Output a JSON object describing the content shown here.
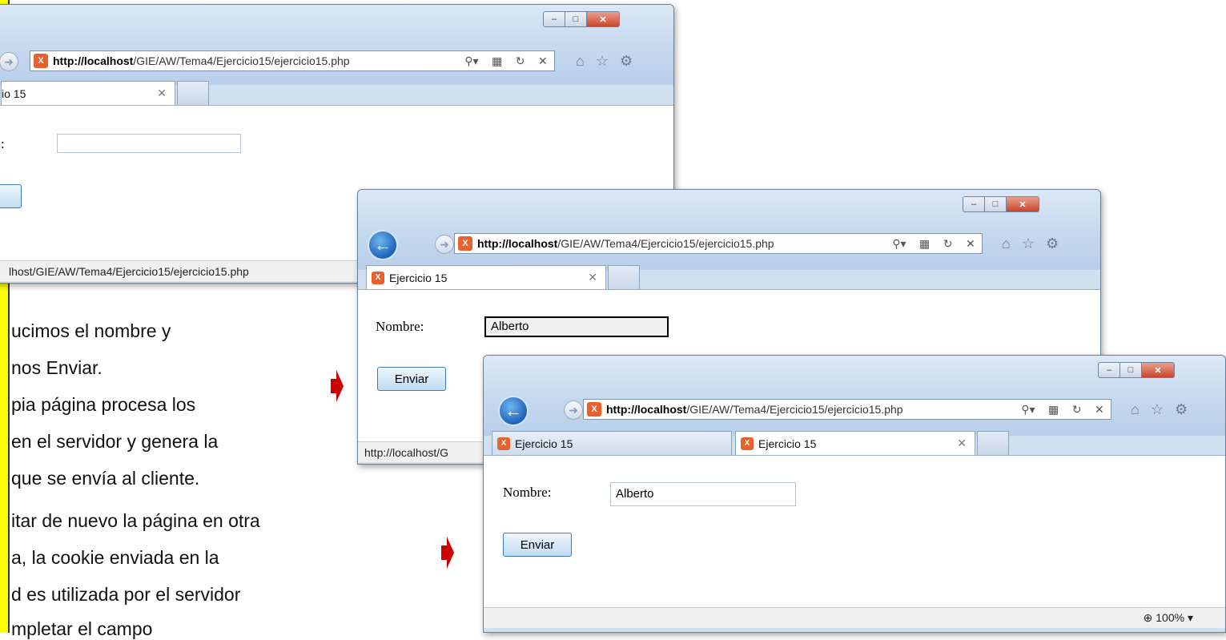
{
  "slide": {
    "lines_group1": [
      "ucimos el nombre y",
      "nos Enviar.",
      "pia página procesa los",
      "en el servidor y genera la",
      " que se envía al cliente."
    ],
    "lines_group2": [
      "itar de nuevo la página en otra",
      "a, la cookie enviada en la",
      "d es utilizada por el servidor",
      "mpletar el campo"
    ]
  },
  "window1": {
    "url_host": "http://localhost",
    "url_path": "/GIE/AW/Tema4/Ejercicio15/ejercicio15.php",
    "tab_label": "io 15",
    "field_label": ":",
    "field_value": "",
    "status_url": "lhost/GIE/AW/Tema4/Ejercicio15/ejercicio15.php"
  },
  "window2": {
    "url_host": "http://localhost",
    "url_path": "/GIE/AW/Tema4/Ejercicio15/ejercicio15.php",
    "tab_label": "Ejercicio 15",
    "field_label": "Nombre:",
    "field_value": "Alberto",
    "button_label": "Enviar",
    "status_url": "http://localhost/G"
  },
  "window3": {
    "url_host": "http://localhost",
    "url_path": "/GIE/AW/Tema4/Ejercicio15/ejercicio15.php",
    "tab1_label": "Ejercicio 15",
    "tab2_label": "Ejercicio 15",
    "field_label": "Nombre:",
    "field_value": "Alberto",
    "button_label": "Enviar",
    "zoom_label": "100%"
  },
  "icons": {
    "minimize": "minimize-icon",
    "maximize": "maximize-icon",
    "close": "close-icon",
    "home": "home-icon",
    "favorites": "star-icon",
    "tools": "gear-icon"
  },
  "colors": {
    "accent_yellow": "#ffff00",
    "arrow_red": "#cc0000",
    "back_button_blue": "#1c64b8"
  }
}
